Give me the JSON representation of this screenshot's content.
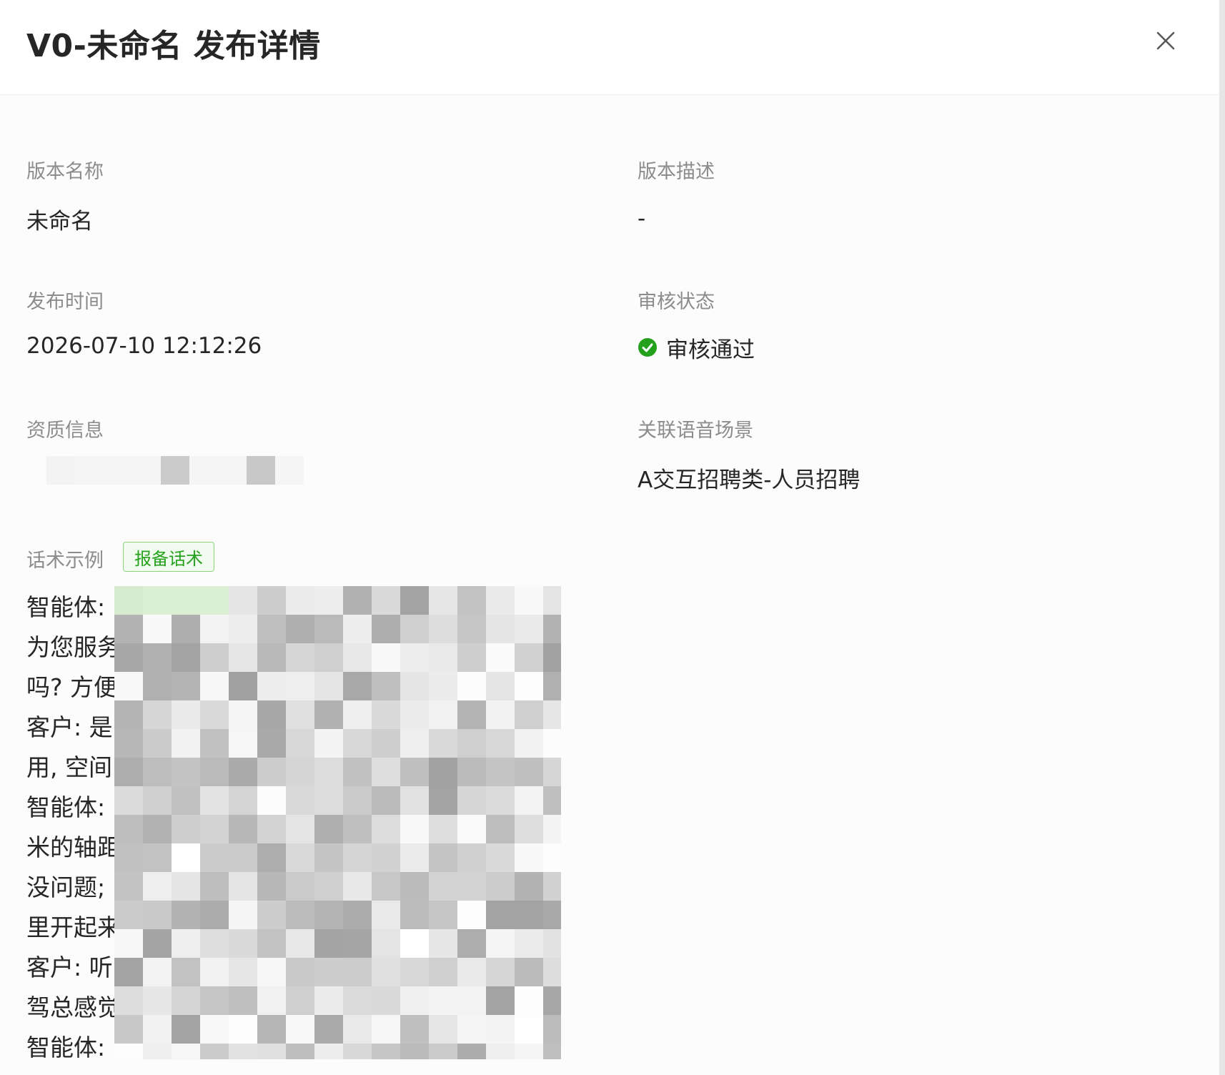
{
  "header": {
    "title": "V0-未命名 发布详情",
    "close_icon": "close-icon"
  },
  "fields": {
    "version_name": {
      "label": "版本名称",
      "value": "未命名"
    },
    "version_desc": {
      "label": "版本描述",
      "value": "-"
    },
    "publish_time": {
      "label": "发布时间",
      "value": "2026-07-10 12:12:26"
    },
    "review_status": {
      "label": "审核状态",
      "value": "审核通过",
      "icon": "check-circle-icon",
      "color": "#23a11c"
    },
    "qualification": {
      "label": "资质信息"
    },
    "voice_scene": {
      "label": "关联语音场景",
      "value": "A交互招聘类-人员招聘"
    },
    "script_example": {
      "label": "话术示例",
      "tag": "报备话术"
    }
  },
  "script_lines": [
    "智能体:",
    "为您服务",
    "吗? 方便",
    "客户: 是",
    "用, 空间",
    "智能体:",
    "米的轴距",
    "没问题;",
    "里开起来",
    "客户: 听",
    "驾总感觉",
    "智能体:"
  ],
  "colors": {
    "accent_green": "#23a11c",
    "tag_border": "#8fd37a",
    "tag_bg": "#f2fbef",
    "label_gray": "#8c8c8c",
    "text_dark": "#262626"
  }
}
